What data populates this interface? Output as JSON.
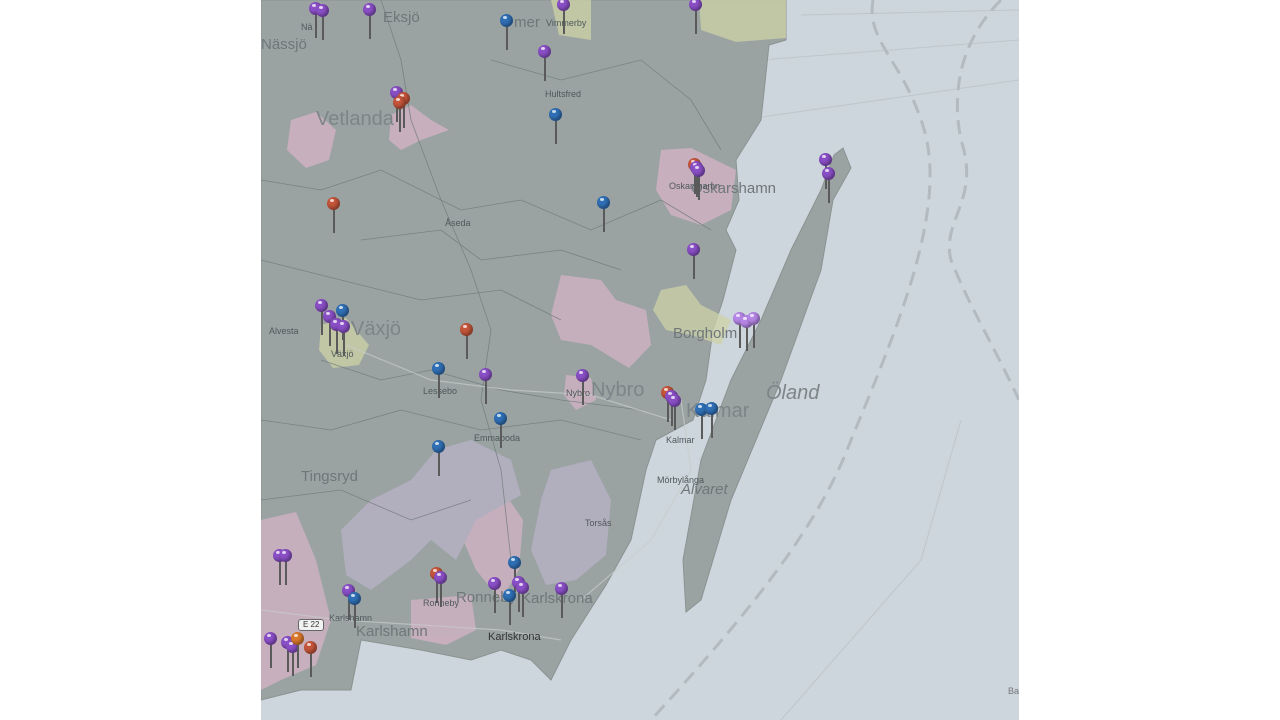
{
  "map": {
    "labels": {
      "eksjo": "Eksjö",
      "nassjo": "Nässjö",
      "nassjo_partial": "Nä",
      "vetlanda": "Vetlanda",
      "hultsfred": "Hultsfred",
      "vimmerby": "Vimmerby",
      "vimmerby_big": "mer",
      "oskarshamn": "Oskarshamn",
      "oskarshamn_small": "Oskarshamn",
      "aseda": "Åseda",
      "vaxjo": "Växjö",
      "vaxjo_small": "Växjö",
      "alvesta": "Alvesta",
      "borgholm": "Borgholm",
      "lessebo": "Lessebo",
      "nybro": "Nybro",
      "nybro_small": "Nybro",
      "kalmar": "Kalmar",
      "kalmar_small": "Kalmar",
      "oland": "Öland",
      "morbylanga": "Mörbylånga",
      "alvaret": "Alvaret",
      "emmaboda": "Emmaboda",
      "tingsryd": "Tingsryd",
      "torsas": "Torsås",
      "ronneby": "Ronneby",
      "ronneby_big": "Ronneby",
      "karlskrona": "Karlskrona",
      "karlskrona_big": "Karlskrona",
      "karlshamn": "Karlshamn",
      "karlshamn_big": "Karlshamn",
      "road": "E 22",
      "attribution": "Ba"
    },
    "pin_colors": {
      "purple": "#8a4fc6",
      "blue": "#2f6fb5",
      "red": "#c4553a",
      "orange": "#d9782a",
      "light_purple": "#b586e6"
    },
    "colors": {
      "water": "#cdd6dc",
      "land": "#9aa3a2",
      "region_pink": "#d5b3c6",
      "region_yellow": "#cdd2a6",
      "region_lavender": "#b9b2c8"
    }
  }
}
